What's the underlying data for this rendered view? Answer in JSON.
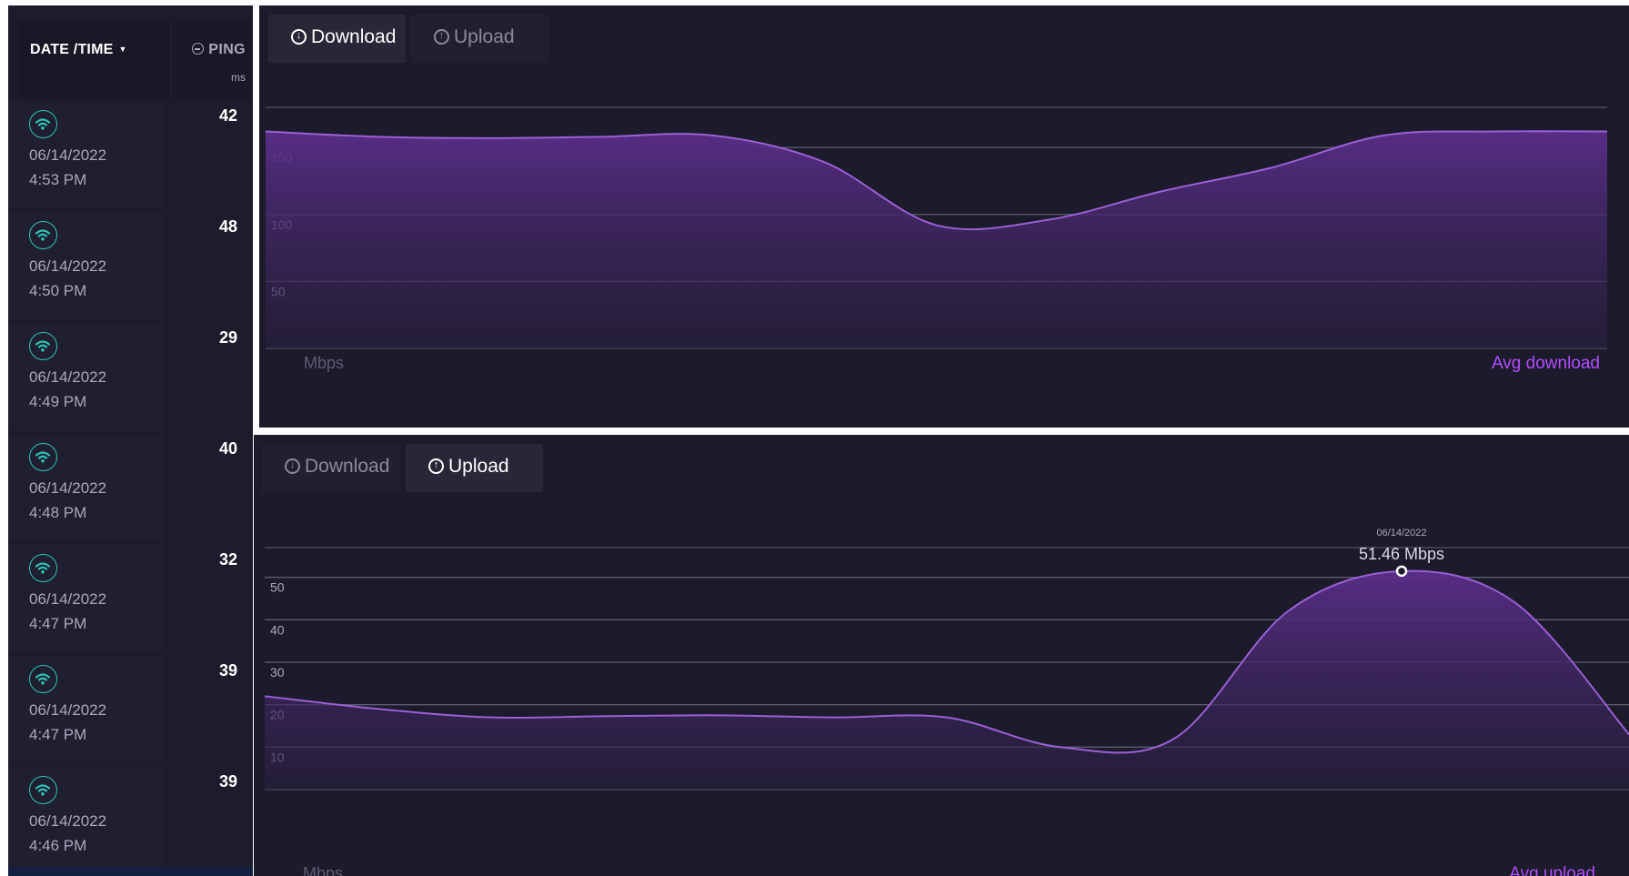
{
  "results": {
    "header": {
      "date_time": "DATE /TIME",
      "ping": "PING",
      "ping_unit": "ms"
    },
    "rows": [
      {
        "ping": "42",
        "date": "06/14/2022",
        "time": "4:53 PM"
      },
      {
        "ping": "48",
        "date": "06/14/2022",
        "time": "4:50 PM"
      },
      {
        "ping": "29",
        "date": "06/14/2022",
        "time": "4:49 PM"
      },
      {
        "ping": "40",
        "date": "06/14/2022",
        "time": "4:48 PM"
      },
      {
        "ping": "32",
        "date": "06/14/2022",
        "time": "4:47 PM"
      },
      {
        "ping": "39",
        "date": "06/14/2022",
        "time": "4:47 PM"
      },
      {
        "ping": "39",
        "date": "06/14/2022",
        "time": "4:46 PM"
      }
    ]
  },
  "download_panel": {
    "tabs": {
      "download": "Download",
      "upload": "Upload"
    },
    "active_tab": "download",
    "unit": "Mbps",
    "avg_label": "Avg download"
  },
  "upload_panel": {
    "tabs": {
      "download": "Download",
      "upload": "Upload"
    },
    "active_tab": "upload",
    "unit": "Mbps",
    "avg_label": "Avg upload",
    "tooltip": {
      "date": "06/14/2022",
      "value": "51.46 Mbps"
    }
  },
  "colors": {
    "accent": "#b44cff",
    "line": "#9b5fd6",
    "wifi": "#2ec4b6",
    "background": "#1b1b2b"
  },
  "chart_data": [
    {
      "type": "area",
      "series": [
        {
          "values": [
            162,
            158,
            157,
            158,
            159,
            139,
            92,
            96,
            117,
            135,
            159,
            162,
            162
          ]
        }
      ],
      "ylim": [
        0,
        180
      ],
      "yticks": [
        50,
        100,
        150
      ],
      "ylabel": "Mbps",
      "annotation": "Avg download"
    },
    {
      "type": "area",
      "series": [
        {
          "values": [
            22,
            19,
            17,
            17.3,
            17.5,
            17,
            17,
            10,
            12,
            42,
            51.46,
            44,
            13
          ]
        }
      ],
      "ylim": [
        0,
        57
      ],
      "yticks": [
        10,
        20,
        30,
        40,
        50
      ],
      "ylabel": "Mbps",
      "annotation": "Avg upload",
      "highlight": {
        "index": 10,
        "date": "06/14/2022",
        "value": "51.46 Mbps"
      }
    }
  ]
}
